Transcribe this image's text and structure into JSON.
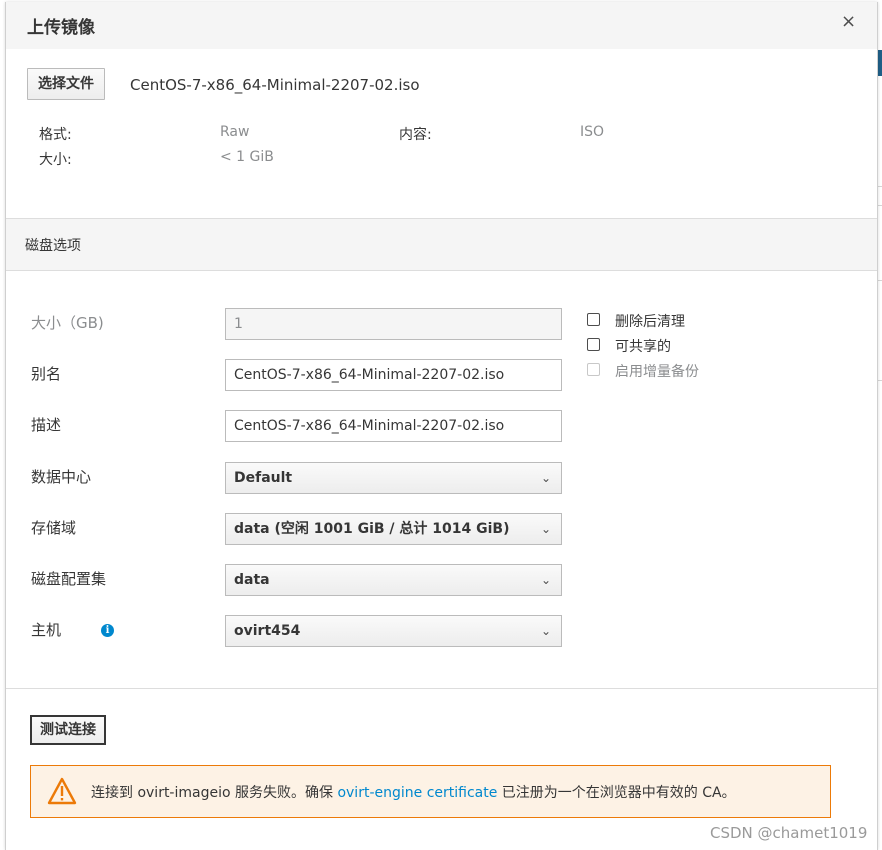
{
  "modal": {
    "title": "上传镜像",
    "close_label": "×"
  },
  "file": {
    "choose_button": "选择文件",
    "name": "CentOS-7-x86_64-Minimal-2207-02.iso"
  },
  "info": {
    "format_label": "格式:",
    "format_value": "Raw",
    "content_label": "内容:",
    "content_value": "ISO",
    "size_label": "大小:",
    "size_value": "< 1 GiB"
  },
  "disk_options": {
    "title": "磁盘选项",
    "size_label": "大小（GB)",
    "size_value": "1",
    "alias_label": "别名",
    "alias_value": "CentOS-7-x86_64-Minimal-2207-02.iso",
    "description_label": "描述",
    "description_value": "CentOS-7-x86_64-Minimal-2207-02.iso",
    "datacenter_label": "数据中心",
    "datacenter_value": "Default",
    "storage_label": "存储域",
    "storage_value": "data (空闲 1001 GiB / 总计 1014 GiB)",
    "profile_label": "磁盘配置集",
    "profile_value": "data",
    "host_label": "主机",
    "host_value": "ovirt454",
    "wipe_label": "删除后清理",
    "shareable_label": "可共享的",
    "incremental_label": "启用增量备份"
  },
  "test_button": "测试连接",
  "alert": {
    "text_before": "连接到 ovirt-imageio 服务失败。确保 ",
    "link": "ovirt-engine certificate",
    "text_after": " 已注册为一个在浏览器中有效的 CA。"
  },
  "watermark": "CSDN @chamet1019",
  "colors": {
    "accent": "#0088ce",
    "warning": "#ec7a08",
    "warning_bg": "#fdf2e5",
    "header_bg": "#f5f5f5"
  },
  "icons": {
    "info": "info-circle-icon",
    "warning": "warning-triangle-icon",
    "dropdown": "chevron-down-icon"
  }
}
